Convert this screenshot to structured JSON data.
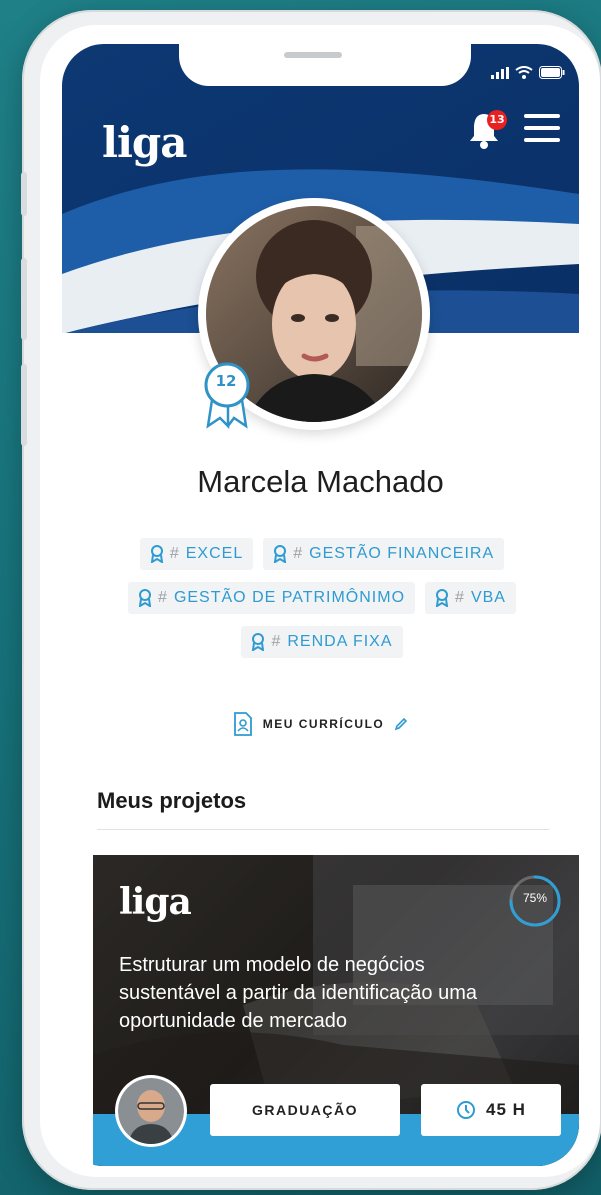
{
  "status_bar": {
    "signal_icon": "signal-icon",
    "wifi_icon": "wifi-icon",
    "battery_icon": "battery-icon"
  },
  "header": {
    "logo": "liga",
    "notification_count": "13",
    "icons": {
      "bell": "bell-icon",
      "menu": "menu-icon"
    },
    "colors": {
      "primary": "#0d3c7a",
      "secondary": "#1a5aa0"
    }
  },
  "profile": {
    "name": "Marcela Machado",
    "level": "12",
    "tags": [
      {
        "hash": "#",
        "label": "EXCEL"
      },
      {
        "hash": "#",
        "label": "GESTÃO FINANCEIRA"
      },
      {
        "hash": "#",
        "label": "GESTÃO DE PATRIMÔNIMO"
      },
      {
        "hash": "#",
        "label": "VBA"
      },
      {
        "hash": "#",
        "label": "RENDA FIXA"
      }
    ],
    "cv_label": "MEU CURRÍCULO"
  },
  "projects": {
    "section_title": "Meus projetos",
    "items": [
      {
        "logo": "liga",
        "progress": 75,
        "progress_label": "75%",
        "title": "Estruturar um modelo de negócios sustentável a partir da identificação uma oportunidade de mercado",
        "level": "GRADUAÇÃO",
        "hours": "45 H"
      }
    ]
  },
  "colors": {
    "accent": "#2f9fd6",
    "background": "#1a767e"
  }
}
